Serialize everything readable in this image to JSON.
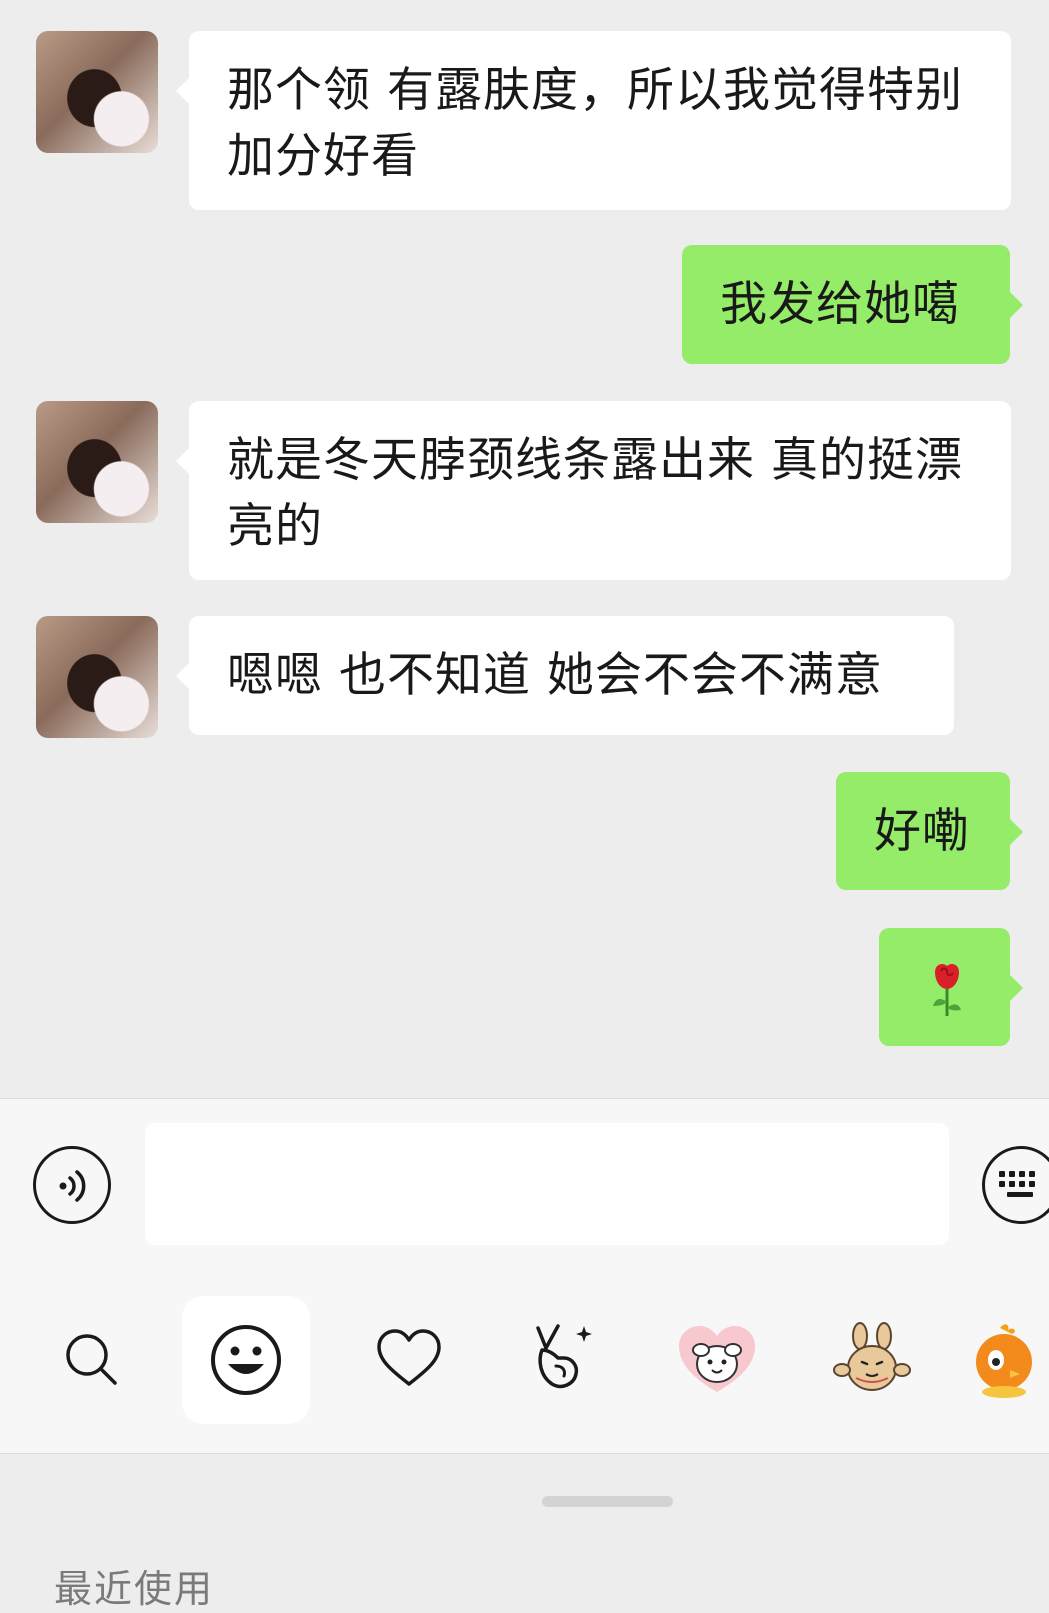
{
  "messages": [
    {
      "side": "left",
      "text": "那个领 有露肤度，所以我觉得特别加分好看"
    },
    {
      "side": "right",
      "text": "我发给她噶"
    },
    {
      "side": "left",
      "text": "就是冬天脖颈线条露出来 真的挺漂亮的"
    },
    {
      "side": "left",
      "text": "嗯嗯 也不知道 她会不会不满意"
    },
    {
      "side": "right",
      "text": "好嘞"
    },
    {
      "side": "right",
      "icon": "rose-emoji"
    }
  ],
  "input": {
    "value": "",
    "placeholder": ""
  },
  "emoji_tabs": [
    {
      "icon": "search-icon"
    },
    {
      "icon": "smiley-icon",
      "active": true
    },
    {
      "icon": "heart-icon"
    },
    {
      "icon": "victory-hand-icon"
    },
    {
      "icon": "white-puppy-sticker"
    },
    {
      "icon": "bunny-sticker"
    },
    {
      "icon": "orange-chick-sticker"
    }
  ],
  "panel": {
    "section_label": "最近使用"
  },
  "colors": {
    "background": "#ededed",
    "sent_bubble": "#95ec69",
    "received_bubble": "#ffffff",
    "toolbar": "#f7f7f7"
  }
}
